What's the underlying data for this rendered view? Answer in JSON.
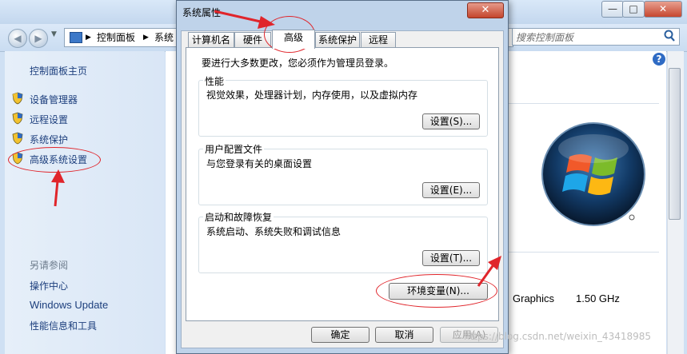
{
  "background": {
    "breadcrumb": [
      "控制面板",
      "系统"
    ],
    "search_placeholder": "搜索控制面板",
    "sidebar": {
      "home": "控制面板主页",
      "links": [
        "设备管理器",
        "远程设置",
        "系统保护",
        "高级系统设置"
      ],
      "see_also_title": "另请参阅",
      "see_also": [
        "操作中心",
        "Windows Update",
        "性能信息和工具"
      ]
    },
    "info": {
      "graphics": "Graphics",
      "cpu_speed": "1.50 GHz"
    }
  },
  "dialog": {
    "title": "系统属性",
    "close_label": "✕",
    "tabs": [
      "计算机名",
      "硬件",
      "高级",
      "系统保护",
      "远程"
    ],
    "active_tab": "高级",
    "admin_note": "要进行大多数更改，您必须作为管理员登录。",
    "groups": [
      {
        "title": "性能",
        "desc": "视觉效果，处理器计划，内存使用，以及虚拟内存",
        "button": "设置(S)..."
      },
      {
        "title": "用户配置文件",
        "desc": "与您登录有关的桌面设置",
        "button": "设置(E)..."
      },
      {
        "title": "启动和故障恢复",
        "desc": "系统启动、系统失败和调试信息",
        "button": "设置(T)..."
      }
    ],
    "env_button": "环境变量(N)...",
    "ok": "确定",
    "cancel": "取消",
    "apply": "应用(A)"
  },
  "watermark": "https://blog.csdn.net/weixin_43418985",
  "colors": {
    "annotation": "#e0252b",
    "link": "#1d3f7d",
    "title_bar": "#bfd3ea"
  }
}
